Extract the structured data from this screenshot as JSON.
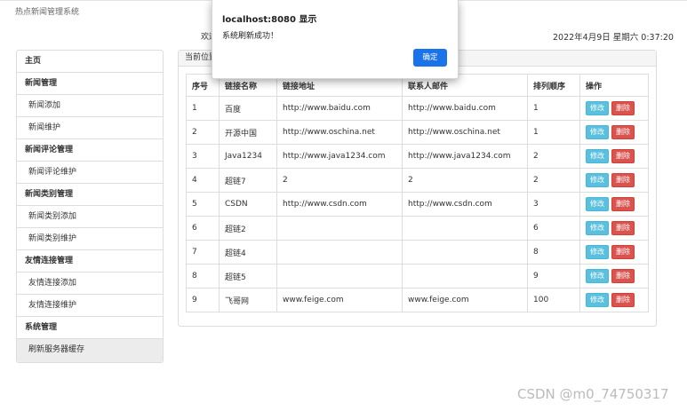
{
  "app": {
    "title": "热点新闻管理系统",
    "welcome": "欢迎",
    "datetime": "2022年4月9日 星期六 0:37:20"
  },
  "sidebar": {
    "items": [
      {
        "label": "主页",
        "type": "head"
      },
      {
        "label": "新闻管理",
        "type": "head"
      },
      {
        "label": "新闻添加",
        "type": "sub"
      },
      {
        "label": "新闻维护",
        "type": "sub"
      },
      {
        "label": "新闻评论管理",
        "type": "head"
      },
      {
        "label": "新闻评论维护",
        "type": "sub"
      },
      {
        "label": "新闻类别管理",
        "type": "head"
      },
      {
        "label": "新闻类别添加",
        "type": "sub"
      },
      {
        "label": "新闻类别维护",
        "type": "sub"
      },
      {
        "label": "友情连接管理",
        "type": "head"
      },
      {
        "label": "友情连接添加",
        "type": "sub"
      },
      {
        "label": "友情连接维护",
        "type": "sub"
      },
      {
        "label": "系统管理",
        "type": "head"
      },
      {
        "label": "刷新服务器缓存",
        "type": "sub active"
      }
    ]
  },
  "main": {
    "breadcrumb": "当前位置",
    "table": {
      "headers": [
        "序号",
        "链接名称",
        "链接地址",
        "联系人邮件",
        "排列顺序",
        "操作"
      ],
      "rows": [
        [
          "1",
          "百度",
          "http://www.baidu.com",
          "http://www.baidu.com",
          "1"
        ],
        [
          "2",
          "开源中国",
          "http://www.oschina.net",
          "http://www.oschina.net",
          "1"
        ],
        [
          "3",
          "Java1234",
          "http://www.java1234.com",
          "http://www.java1234.com",
          "2"
        ],
        [
          "4",
          "超链7",
          "2",
          "2",
          "2"
        ],
        [
          "5",
          "CSDN",
          "http://www.csdn.com",
          "http://www.csdn.com",
          "3"
        ],
        [
          "6",
          "超链2",
          "",
          "",
          "6"
        ],
        [
          "7",
          "超链4",
          "",
          "",
          "8"
        ],
        [
          "8",
          "超链5",
          "",
          "",
          "9"
        ],
        [
          "9",
          "飞哥网",
          "www.feige.com",
          "www.feige.com",
          "100"
        ]
      ],
      "edit_label": "修改",
      "delete_label": "删除"
    }
  },
  "dialog": {
    "title": "localhost:8080 显示",
    "message": "系统刷新成功！",
    "ok_label": "确定"
  },
  "watermark": "CSDN @m0_74750317",
  "colors": {
    "edit": "#5bc0de",
    "delete": "#d9534f",
    "ok": "#1a73e8"
  }
}
